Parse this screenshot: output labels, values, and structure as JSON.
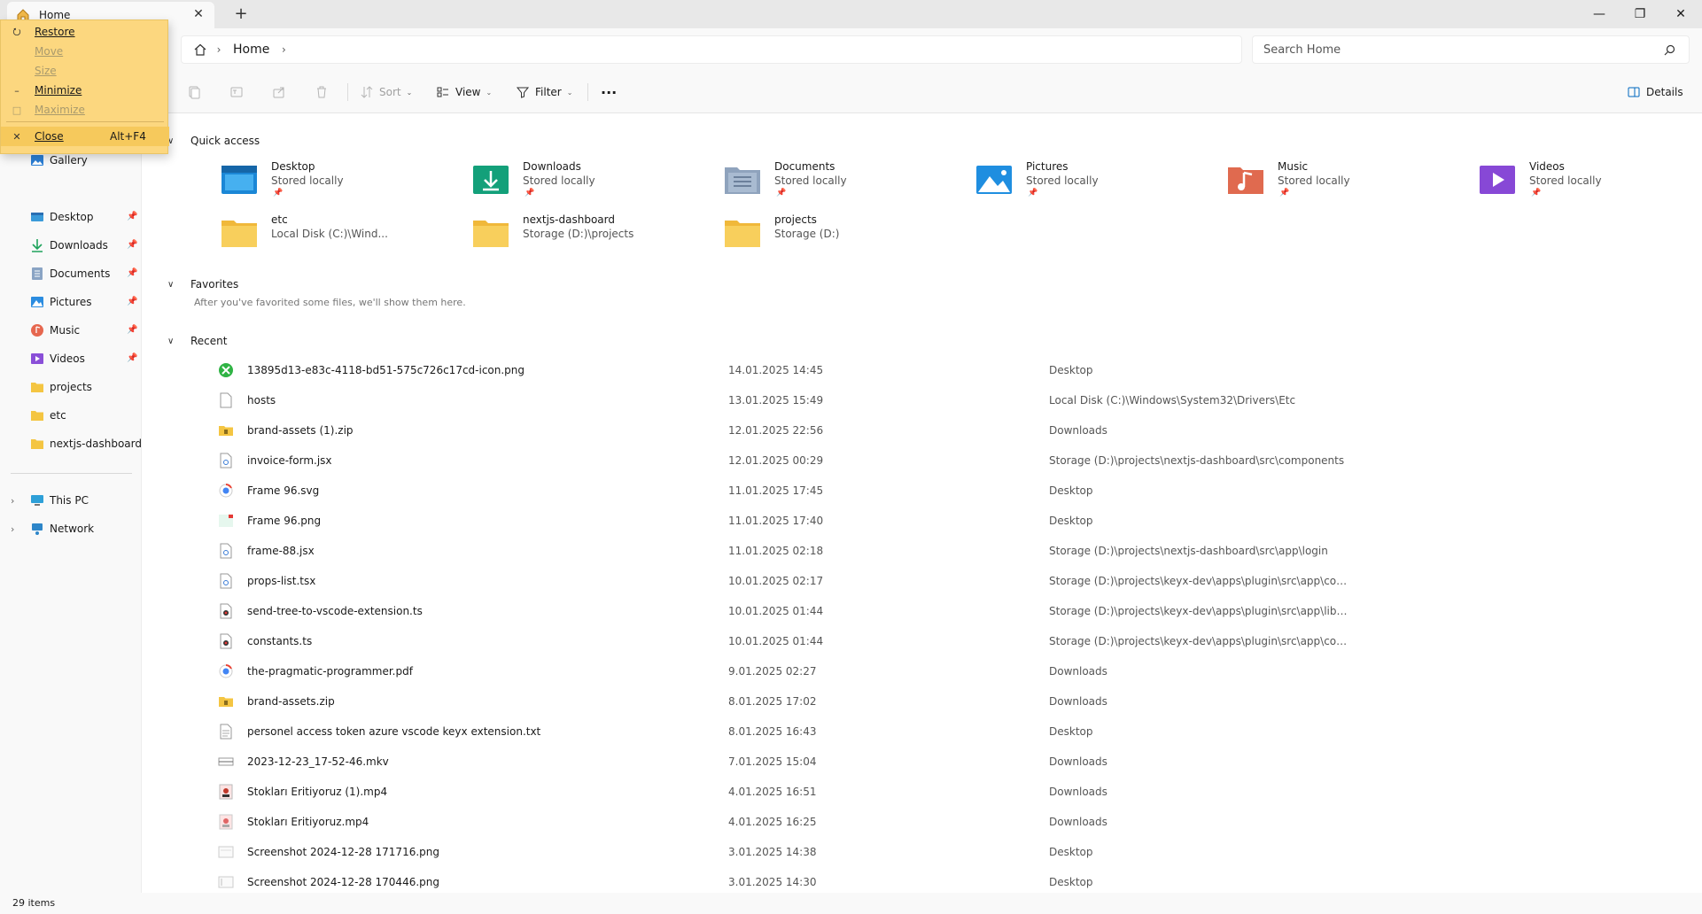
{
  "titlebar": {
    "tab_label": "Home",
    "new_tab": "+",
    "close_tab": "✕",
    "minimize": "—",
    "maximize": "❐",
    "close": "✕"
  },
  "address": {
    "crumb_home": "Home",
    "search_placeholder": "Search Home"
  },
  "toolbar": {
    "sort_label": "Sort",
    "view_label": "View",
    "filter_label": "Filter",
    "more_label": "···",
    "details_label": "Details"
  },
  "sidebar": {
    "items": [
      {
        "label": "Gallery"
      },
      {
        "label": "Desktop"
      },
      {
        "label": "Downloads"
      },
      {
        "label": "Documents"
      },
      {
        "label": "Pictures"
      },
      {
        "label": "Music"
      },
      {
        "label": "Videos"
      },
      {
        "label": "projects"
      },
      {
        "label": "etc"
      },
      {
        "label": "nextjs-dashboard"
      },
      {
        "label": "This PC"
      },
      {
        "label": "Network"
      }
    ]
  },
  "sections": {
    "quick_access": "Quick access",
    "favorites": "Favorites",
    "favorites_empty": "After you've favorited some files, we'll show them here.",
    "recent": "Recent"
  },
  "quick_access": [
    {
      "name": "Desktop",
      "sub": "Stored locally"
    },
    {
      "name": "Downloads",
      "sub": "Stored locally"
    },
    {
      "name": "Documents",
      "sub": "Stored locally"
    },
    {
      "name": "Pictures",
      "sub": "Stored locally"
    },
    {
      "name": "Music",
      "sub": "Stored locally"
    },
    {
      "name": "Videos",
      "sub": "Stored locally"
    },
    {
      "name": "etc",
      "sub": "Local Disk (C:)\\Wind..."
    },
    {
      "name": "nextjs-dashboard",
      "sub": "Storage (D:)\\projects"
    },
    {
      "name": "projects",
      "sub": "Storage (D:)"
    }
  ],
  "recent": [
    {
      "name": "13895d13-e83c-4118-bd51-575c726c17cd-icon.png",
      "date": "14.01.2025 14:45",
      "loc": "Desktop"
    },
    {
      "name": "hosts",
      "date": "13.01.2025 15:49",
      "loc": "Local Disk (C:)\\Windows\\System32\\Drivers\\Etc"
    },
    {
      "name": "brand-assets (1).zip",
      "date": "12.01.2025 22:56",
      "loc": "Downloads"
    },
    {
      "name": "invoice-form.jsx",
      "date": "12.01.2025 00:29",
      "loc": "Storage (D:)\\projects\\nextjs-dashboard\\src\\components"
    },
    {
      "name": "Frame 96.svg",
      "date": "11.01.2025 17:45",
      "loc": "Desktop"
    },
    {
      "name": "Frame 96.png",
      "date": "11.01.2025 17:40",
      "loc": "Desktop"
    },
    {
      "name": "frame-88.jsx",
      "date": "11.01.2025 02:18",
      "loc": "Storage (D:)\\projects\\nextjs-dashboard\\src\\app\\login"
    },
    {
      "name": "props-list.tsx",
      "date": "10.01.2025 02:17",
      "loc": "Storage (D:)\\projects\\keyx-dev\\apps\\plugin\\src\\app\\compone..."
    },
    {
      "name": "send-tree-to-vscode-extension.ts",
      "date": "10.01.2025 01:44",
      "loc": "Storage (D:)\\projects\\keyx-dev\\apps\\plugin\\src\\app\\lib\\utils"
    },
    {
      "name": "constants.ts",
      "date": "10.01.2025 01:44",
      "loc": "Storage (D:)\\projects\\keyx-dev\\apps\\plugin\\src\\app\\compone..."
    },
    {
      "name": "the-pragmatic-programmer.pdf",
      "date": "9.01.2025 02:27",
      "loc": "Downloads"
    },
    {
      "name": "brand-assets.zip",
      "date": "8.01.2025 17:02",
      "loc": "Downloads"
    },
    {
      "name": "personel access token azure vscode keyx extension.txt",
      "date": "8.01.2025 16:43",
      "loc": "Desktop"
    },
    {
      "name": "2023-12-23_17-52-46.mkv",
      "date": "7.01.2025 15:04",
      "loc": "Downloads"
    },
    {
      "name": "Stokları Eritiyoruz (1).mp4",
      "date": "4.01.2025 16:51",
      "loc": "Downloads"
    },
    {
      "name": "Stokları Eritiyoruz.mp4",
      "date": "4.01.2025 16:25",
      "loc": "Downloads"
    },
    {
      "name": "Screenshot 2024-12-28 171716.png",
      "date": "3.01.2025 14:38",
      "loc": "Desktop"
    },
    {
      "name": "Screenshot 2024-12-28 170446.png",
      "date": "3.01.2025 14:30",
      "loc": "Desktop"
    }
  ],
  "status": {
    "items_count": "29 items"
  },
  "context_menu": {
    "restore": "Restore",
    "move": "Move",
    "size": "Size",
    "minimize": "Minimize",
    "maximize": "Maximize",
    "close": "Close",
    "close_accel": "Alt+F4"
  },
  "colors": {
    "menu_bg": "#fcd77f",
    "accent": "#0067c0"
  }
}
